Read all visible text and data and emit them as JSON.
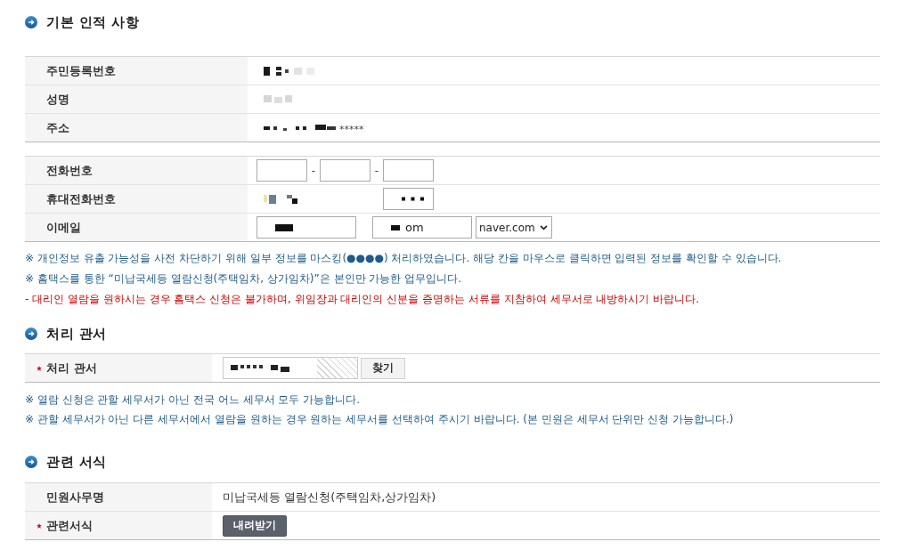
{
  "sections": [
    {
      "title": "기본 인적 사항",
      "tables": [
        {
          "rows": [
            {
              "label": "주민등록번호",
              "required": false,
              "fields": [
                {
                  "kind": "masked"
                }
              ]
            },
            {
              "label": "성명",
              "required": false,
              "fields": [
                {
                  "kind": "masked"
                }
              ]
            },
            {
              "label": "주소",
              "required": false,
              "fields": [
                {
                  "kind": "masked",
                  "text": "*****"
                }
              ]
            }
          ]
        },
        {
          "rows": [
            {
              "label": "전화번호",
              "required": false,
              "fields": [
                {
                  "kind": "input",
                  "masked": false
                },
                {
                  "kind": "separator",
                  "text": "-"
                },
                {
                  "kind": "input",
                  "masked": false
                },
                {
                  "kind": "separator",
                  "text": "-"
                },
                {
                  "kind": "input",
                  "masked": false
                }
              ]
            },
            {
              "label": "휴대전화번호",
              "required": false,
              "fields": [
                {
                  "kind": "masked"
                },
                {
                  "kind": "input",
                  "masked": true
                }
              ]
            },
            {
              "label": "이메일",
              "required": false,
              "fields": [
                {
                  "kind": "textbox",
                  "masked": true
                },
                {
                  "kind": "textbox",
                  "masked": true,
                  "value": "om"
                },
                {
                  "kind": "select",
                  "value": "naver.com"
                }
              ]
            }
          ]
        }
      ],
      "notices": [
        {
          "kind": "info",
          "text": "※ 개인정보 유출 가능성을 사전 차단하기 위해 일부 정보를 마스킹(●●●●) 처리하였습니다. 해당 칸을 마우스로 클릭하면 입력된 정보를 확인할 수 있습니다."
        },
        {
          "kind": "info",
          "text": "※ 홈택스를 통한 “미납국세등 열람신청(주택임차, 상가임차)”은 본인만 가능한 업무입니다."
        },
        {
          "kind": "warning",
          "text": "- 대리인 열람을 원하시는 경우 홈택스 신청은 불가하며, 위임장과 대리인의 신분을 증명하는 서류를 지참하여 세무서로 내방하시기 바랍니다."
        }
      ]
    },
    {
      "title": "처리 관서",
      "tables": [
        {
          "rows": [
            {
              "label": "처리 관서",
              "required": true,
              "fields": [
                {
                  "kind": "readonly",
                  "masked": true
                },
                {
                  "kind": "button",
                  "label": "찾기"
                }
              ]
            }
          ]
        }
      ],
      "notices": [
        {
          "kind": "info",
          "text": "※ 열람 신청은 관할 세무서가 아닌 전국 어느 세무서 모두 가능합니다."
        },
        {
          "kind": "info",
          "text": "※ 관할 세무서가 아닌 다른 세무서에서 열람을 원하는 경우 원하는 세무서를 선택하여 주시기 바랍니다. (본 민원은 세무서 단위만 신청 가능합니다.)"
        }
      ]
    },
    {
      "title": "관련 서식",
      "tables": [
        {
          "rows": [
            {
              "label": "민원사무명",
              "required": false,
              "fields": [
                {
                  "kind": "text",
                  "text": "미납국세등 열람신청(주택임차,상가임차)"
                }
              ]
            },
            {
              "label": "관련서식",
              "required": true,
              "fields": [
                {
                  "kind": "download",
                  "label": "내려받기"
                }
              ]
            }
          ]
        }
      ]
    }
  ]
}
